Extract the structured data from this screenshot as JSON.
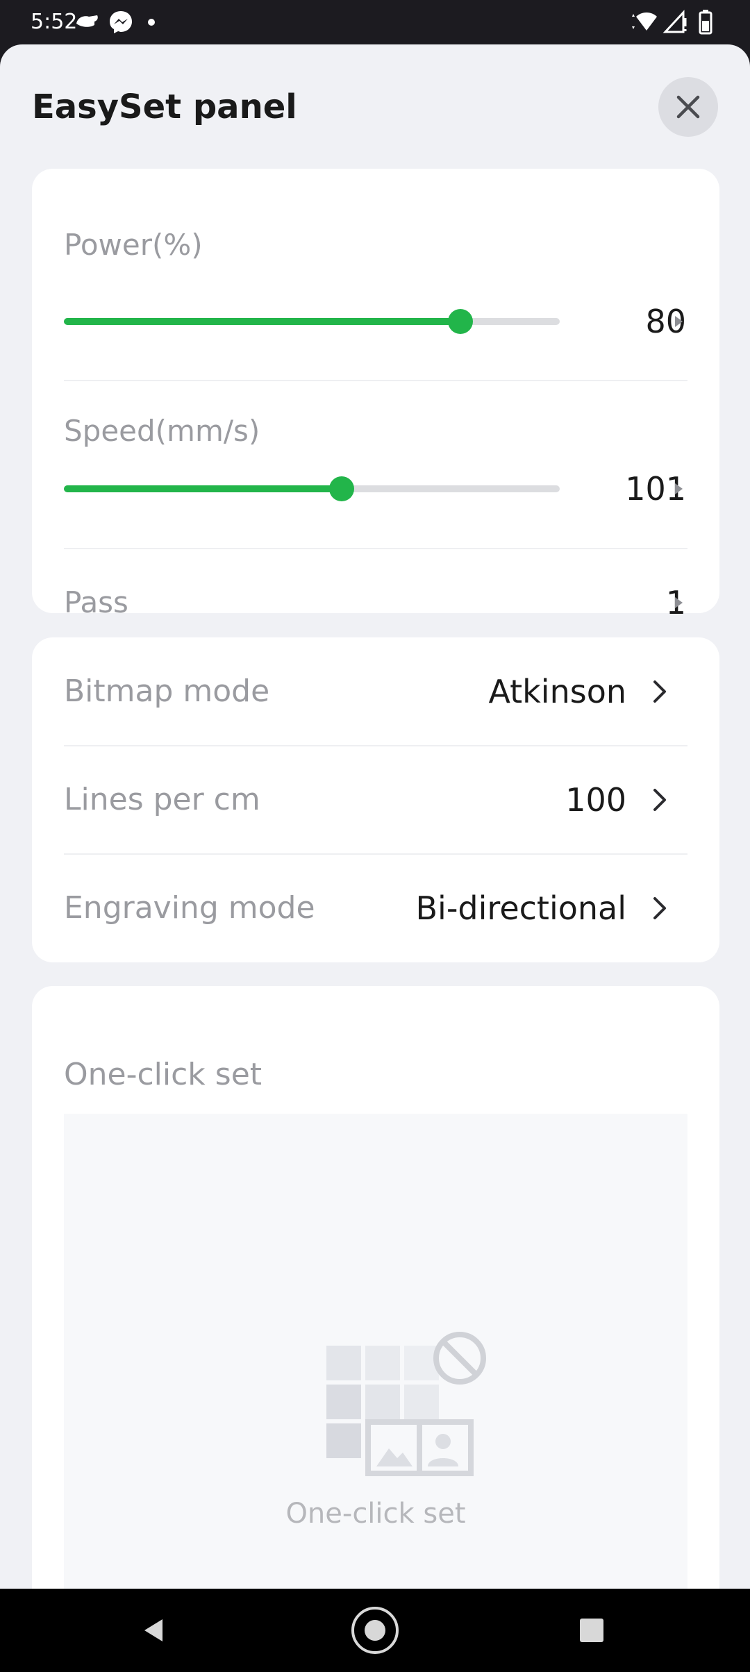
{
  "status_bar": {
    "time": "5:52"
  },
  "sheet": {
    "title": "EasySet panel"
  },
  "laser": {
    "power": {
      "label": "Power(%)",
      "value": "80",
      "fraction": 0.8
    },
    "speed": {
      "label": "Speed(mm/s)",
      "value": "101",
      "fraction": 0.56
    },
    "pass": {
      "label": "Pass",
      "value": "1"
    }
  },
  "image_settings": {
    "bitmap_mode": {
      "label": "Bitmap mode",
      "value": "Atkinson"
    },
    "lines_per_cm": {
      "label": "Lines per cm",
      "value": "100"
    },
    "engraving_mode": {
      "label": "Engraving mode",
      "value": "Bi-directional"
    }
  },
  "one_click": {
    "title": "One-click set",
    "empty_caption": "One-click set"
  },
  "colors": {
    "accent": "#22b54a",
    "label_gray": "#9a9ba0",
    "sheet_bg": "#f0f1f5"
  }
}
